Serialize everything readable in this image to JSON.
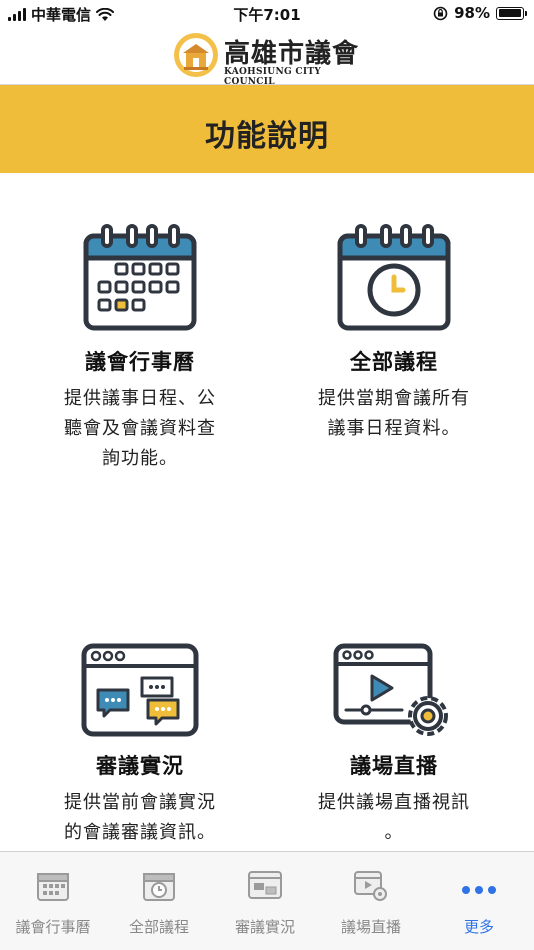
{
  "status_bar": {
    "carrier": "中華電信",
    "time": "下午7:01",
    "battery_percent": "98%",
    "battery_level": 0.98
  },
  "header": {
    "logo_title": "高雄市議會",
    "logo_subtitle": "KAOHSIUNG CITY COUNCIL"
  },
  "banner": {
    "title": "功能說明"
  },
  "features": [
    {
      "title": "議會行事曆",
      "desc": [
        "提供議事日程、公",
        "聽會及會議資料查",
        "詢功能。"
      ]
    },
    {
      "title": "全部議程",
      "desc": [
        "提供當期會議所有",
        "議事日程資料。"
      ]
    },
    {
      "title": "審議實況",
      "desc": [
        "提供當前會議實況",
        "的會議審議資訊。"
      ]
    },
    {
      "title": "議場直播",
      "desc": [
        "提供議場直播視訊",
        "。"
      ]
    }
  ],
  "tab_bar": {
    "tabs": [
      {
        "label": "議會行事曆",
        "icon": "calendar-icon"
      },
      {
        "label": "全部議程",
        "icon": "clock-calendar-icon"
      },
      {
        "label": "審議實況",
        "icon": "chat-window-icon"
      },
      {
        "label": "議場直播",
        "icon": "video-settings-icon"
      },
      {
        "label": "更多",
        "icon": "more-dots-icon"
      }
    ],
    "active_index": 4
  },
  "colors": {
    "banner": "#f0bd3a",
    "icon_blue": "#3e8cb6",
    "icon_dark": "#2f3640",
    "icon_accent": "#f0bd3a",
    "active_tab": "#2f73e6"
  }
}
